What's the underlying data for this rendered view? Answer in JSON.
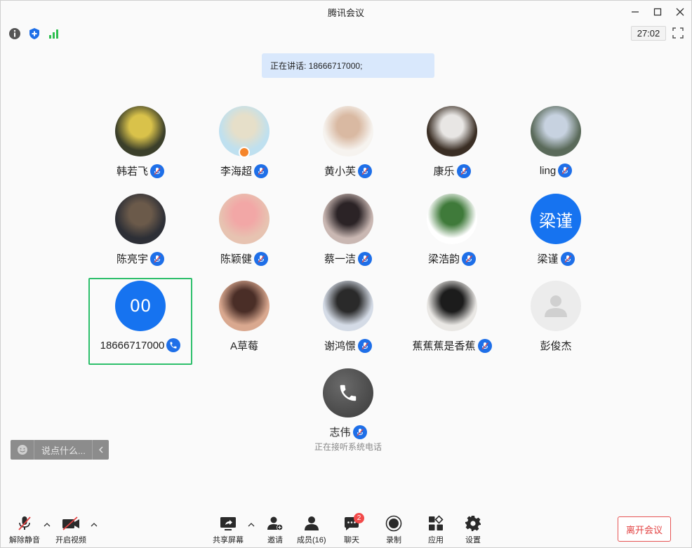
{
  "window": {
    "title": "腾讯会议"
  },
  "top_toolbar": {
    "timer": "27:02"
  },
  "speaking_banner": {
    "text": "正在讲话: 18666717000;"
  },
  "participants": [
    {
      "name": "韩若飞",
      "avatar_kind": "photo",
      "photo_bg": "#3b3f2a",
      "photo_fg": "#d9c24a",
      "mic": "muted"
    },
    {
      "name": "李海超",
      "avatar_kind": "photo",
      "photo_bg": "#bfe0ef",
      "photo_fg": "#e6dfc9",
      "mic": "muted",
      "host": true
    },
    {
      "name": "黄小芙",
      "avatar_kind": "photo",
      "photo_bg": "#f6f3ef",
      "photo_fg": "#d9b9a2",
      "mic": "muted"
    },
    {
      "name": "康乐",
      "avatar_kind": "photo",
      "photo_bg": "#3a2e24",
      "photo_fg": "#e8e6e4",
      "mic": "muted"
    },
    {
      "name": "ling",
      "avatar_kind": "photo",
      "photo_bg": "#5a6a5a",
      "photo_fg": "#c7d2e0",
      "mic": "muted"
    },
    {
      "name": "陈亮宇",
      "avatar_kind": "photo",
      "photo_bg": "#2d2f36",
      "photo_fg": "#6b5a4a",
      "mic": "muted"
    },
    {
      "name": "陈颖健",
      "avatar_kind": "photo",
      "photo_bg": "#e7c3b1",
      "photo_fg": "#f2a7a6",
      "mic": "muted"
    },
    {
      "name": "蔡一洁",
      "avatar_kind": "photo",
      "photo_bg": "#c9b7b2",
      "photo_fg": "#2b2326",
      "mic": "muted"
    },
    {
      "name": "梁浩韵",
      "avatar_kind": "photo",
      "photo_bg": "#ffffff",
      "photo_fg": "#3f7a3a",
      "mic": "muted"
    },
    {
      "name": "梁谨",
      "avatar_kind": "text",
      "avatar_text": "梁谨",
      "bg": "#1673f0",
      "mic": "muted"
    },
    {
      "name": "18666717000",
      "avatar_kind": "text",
      "avatar_text": "00",
      "bg": "#1673f0",
      "mic": "phone",
      "active": true
    },
    {
      "name": "A草莓",
      "avatar_kind": "photo",
      "photo_bg": "#d9a88f",
      "photo_fg": "#4a2e27",
      "mic": "none"
    },
    {
      "name": "谢鸿憬",
      "avatar_kind": "photo",
      "photo_bg": "#d4dbe6",
      "photo_fg": "#2a2a2a",
      "mic": "muted"
    },
    {
      "name": "蕉蕉蕉是香蕉",
      "avatar_kind": "photo",
      "photo_bg": "#e9e7e4",
      "photo_fg": "#1c1c1c",
      "mic": "muted"
    },
    {
      "name": "彭俊杰",
      "avatar_kind": "default",
      "bg": "#ececec",
      "mic": "none"
    },
    {
      "name": "志伟",
      "avatar_kind": "phone",
      "bg": "#3a3a3a",
      "mic": "muted",
      "status": "正在接听系统电话"
    }
  ],
  "chat": {
    "placeholder": "说点什么..."
  },
  "bottom_bar": {
    "unmute": "解除静音",
    "start_video": "开启视频",
    "share_screen": "共享屏幕",
    "invite": "邀请",
    "members": "成员(16)",
    "chat": "聊天",
    "chat_badge": "2",
    "record": "录制",
    "apps": "应用",
    "settings": "设置",
    "leave": "离开会议"
  },
  "colors": {
    "accent": "#1673f0",
    "active_border": "#2dbf6b",
    "danger": "#e24242"
  }
}
